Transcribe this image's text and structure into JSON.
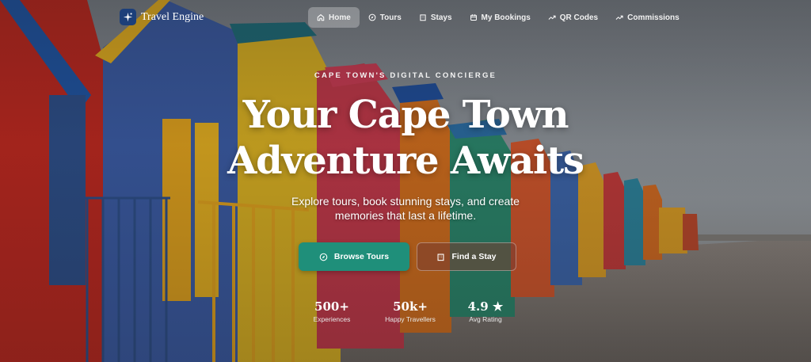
{
  "nav": {
    "brand": "Travel Engine",
    "items": [
      {
        "label": "Home",
        "icon": "home-icon",
        "active": true
      },
      {
        "label": "Tours",
        "icon": "compass-icon",
        "active": false
      },
      {
        "label": "Stays",
        "icon": "building-icon",
        "active": false
      },
      {
        "label": "My Bookings",
        "icon": "calendar-icon",
        "active": false
      },
      {
        "label": "QR Codes",
        "icon": "trend-icon",
        "active": false
      },
      {
        "label": "Commissions",
        "icon": "trend-icon",
        "active": false
      }
    ]
  },
  "hero": {
    "eyebrow": "CAPE TOWN'S DIGITAL CONCIERGE",
    "title_line1": "Your Cape Town",
    "title_line2": "Adventure Awaits",
    "subtitle_line1": "Explore tours, book stunning stays, and create",
    "subtitle_line2": "memories that last a lifetime."
  },
  "buttons": {
    "primary": "Browse Tours",
    "secondary": "Find a Stay"
  },
  "stats": [
    {
      "value": "500+",
      "label": "Experiences"
    },
    {
      "value": "50k+",
      "label": "Happy Travellers"
    },
    {
      "value": "4.9 ★",
      "label": "Avg Rating"
    }
  ],
  "colors": {
    "primary_button": "#1f8f7a",
    "brand_logo": "#1c3f7a"
  }
}
